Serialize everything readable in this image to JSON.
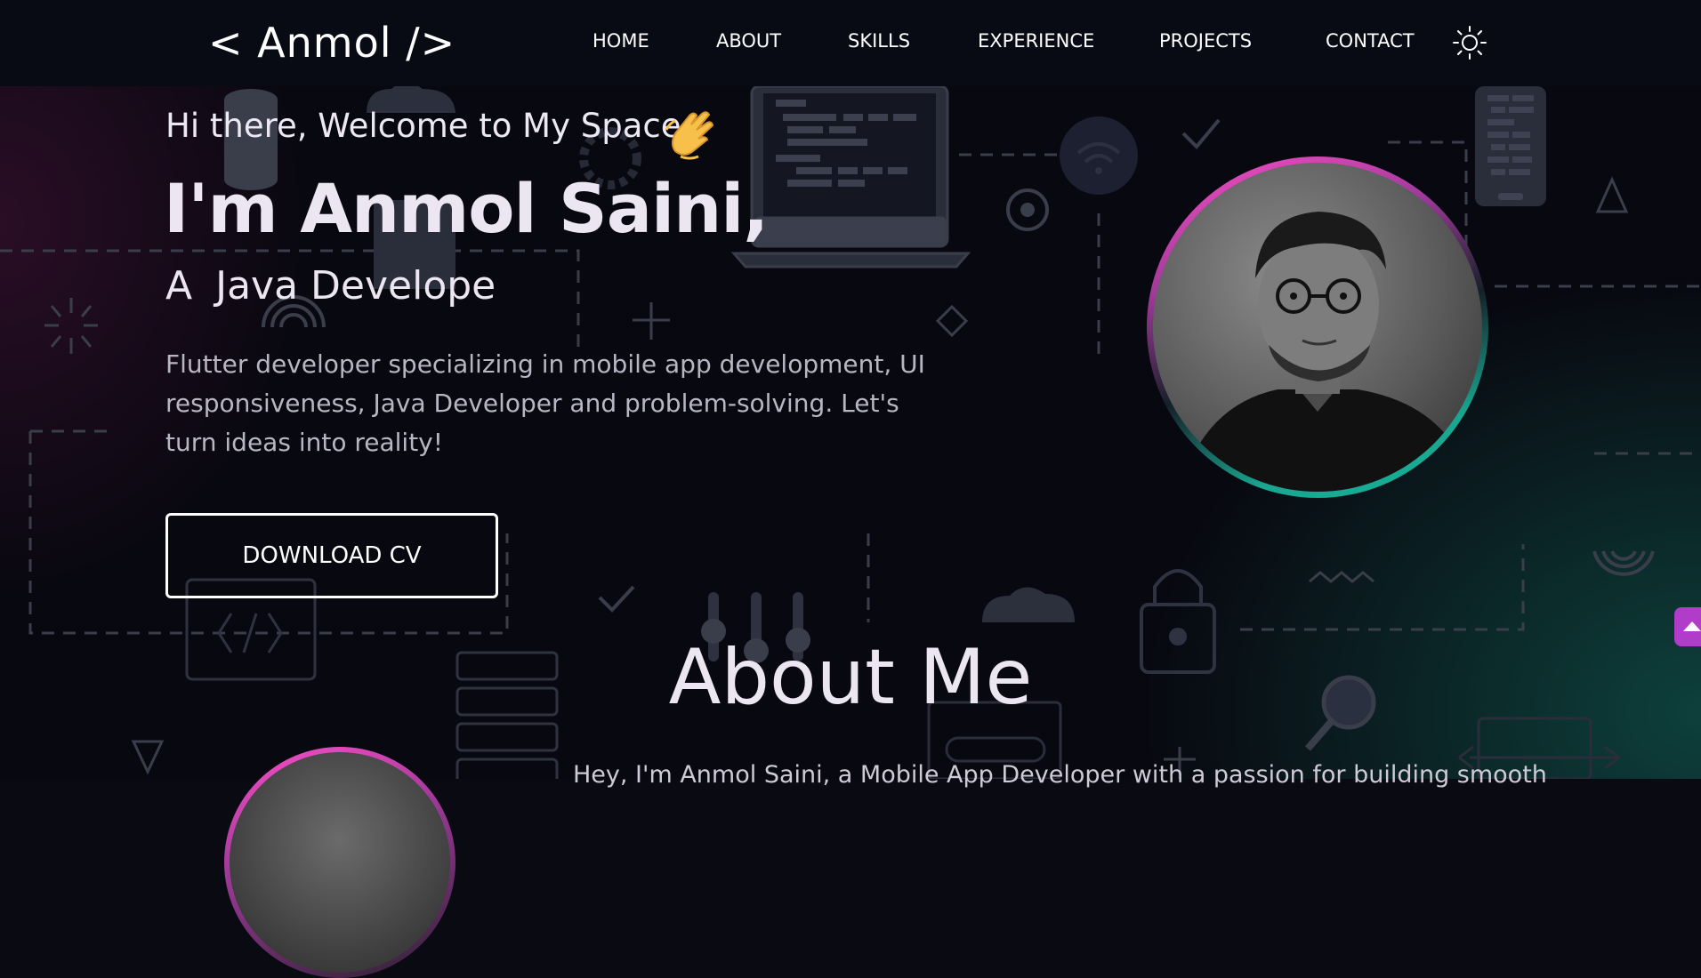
{
  "logo": "< Anmol />",
  "nav": {
    "items": [
      {
        "label": "HOME"
      },
      {
        "label": "ABOUT"
      },
      {
        "label": "SKILLS"
      },
      {
        "label": "EXPERIENCE"
      },
      {
        "label": "PROJECTS"
      },
      {
        "label": "CONTACT"
      }
    ],
    "theme_icon": "sun-icon"
  },
  "hero": {
    "greeting": "Hi there, Welcome to My Space",
    "greeting_emoji": "clapping-hands-icon",
    "name": "I'm Anmol Saini,",
    "role_prefix": "A",
    "role_typed": "Java Develope",
    "description": "Flutter developer specializing in mobile app development, UI responsiveness, Java Developer and problem-solving. Let's turn ideas into reality!",
    "cta_label": "DOWNLOAD CV"
  },
  "about": {
    "title": "About Me",
    "intro": "Hey, I'm Anmol Saini, a Mobile App Developer with a passion for building smooth"
  },
  "colors": {
    "accent_pink": "#ff4fc8",
    "accent_teal": "#13b39a",
    "scroll_top": "#b03cc9",
    "navbar": "#080a14"
  },
  "scroll_top_icon": "arrow-up-icon"
}
